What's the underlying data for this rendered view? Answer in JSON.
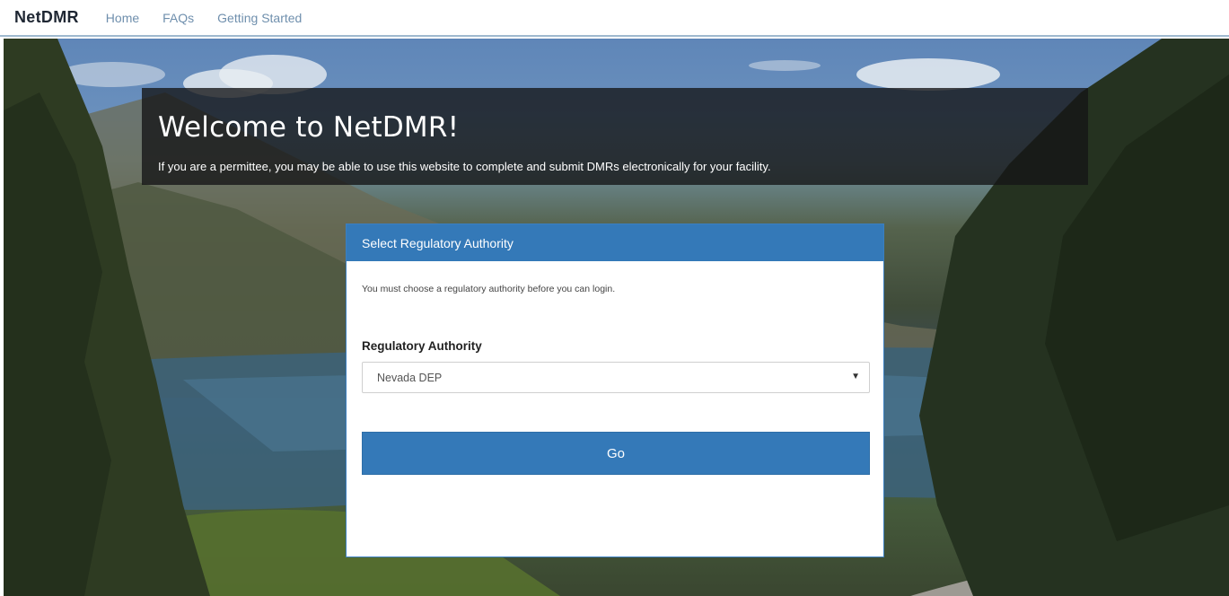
{
  "navbar": {
    "brand": "NetDMR",
    "links": [
      "Home",
      "FAQs",
      "Getting Started"
    ]
  },
  "welcome": {
    "title": "Welcome to NetDMR!",
    "subtitle": "If you are a permittee, you may be able to use this website to complete and submit DMRs electronically for your facility."
  },
  "panel": {
    "heading": "Select Regulatory Authority",
    "note": "You must choose a regulatory authority before you can login.",
    "field_label": "Regulatory Authority",
    "selected_value": "Nevada DEP",
    "go_label": "Go"
  },
  "icons": {
    "select_caret": "▼"
  },
  "colors": {
    "primary": "#3479b8",
    "navbar_border": "#9fb9cf",
    "nav_link": "#6f8fad"
  }
}
